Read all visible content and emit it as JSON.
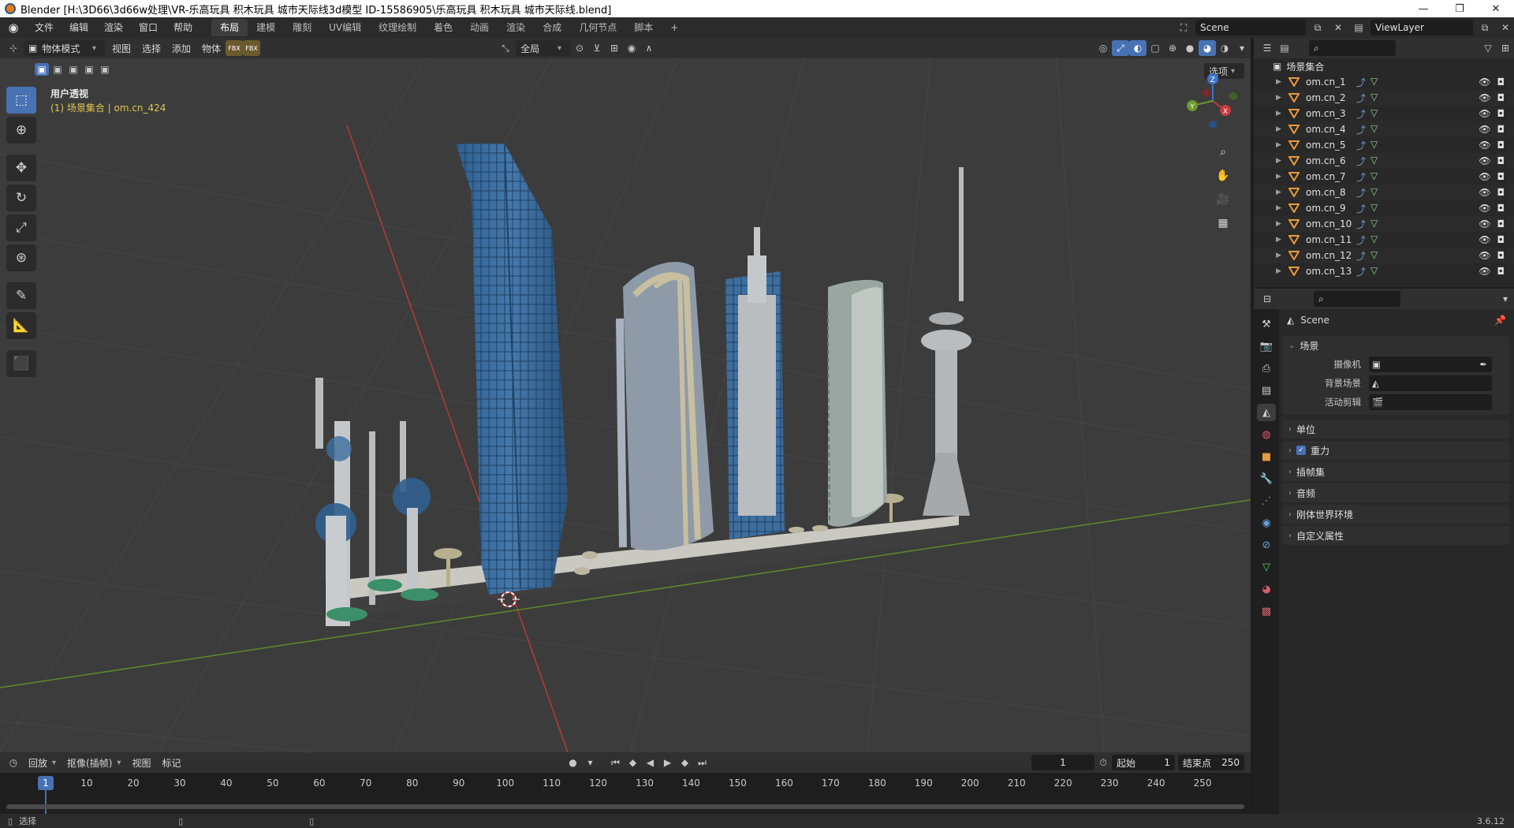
{
  "window": {
    "title": "Blender [H:\\3D66\\3d66w处理\\VR-乐高玩具 积木玩具 城市天际线3d模型 ID-15586905\\乐高玩具 积木玩具 城市天际线.blend]",
    "minimize": "—",
    "maximize": "❐",
    "close": "✕"
  },
  "menu": {
    "items": [
      "文件",
      "编辑",
      "渲染",
      "窗口",
      "帮助"
    ],
    "workspace_tabs": [
      "布局",
      "建模",
      "雕刻",
      "UV编辑",
      "纹理绘制",
      "着色",
      "动画",
      "渲染",
      "合成",
      "几何节点",
      "脚本"
    ],
    "active_tab": "布局",
    "add_tab": "+",
    "scene_name": "Scene",
    "view_layer": "ViewLayer"
  },
  "viewport_header": {
    "mode": "物体模式",
    "menus": [
      "视图",
      "选择",
      "添加",
      "物体"
    ],
    "transform_orientation": "全局",
    "options": "选项"
  },
  "viewport": {
    "view_name": "用户透视",
    "collection_info": "(1) 场景集合 | om.cn_424",
    "gizmo_axes": [
      "X",
      "Y",
      "Z"
    ]
  },
  "timeline": {
    "menus": [
      "回放",
      "抠像(插帧)",
      "视图",
      "标记"
    ],
    "current_frame": "1",
    "start_label": "起始",
    "start": "1",
    "end_label": "结束点",
    "end": "250",
    "ruler": [
      "1",
      "10",
      "20",
      "30",
      "40",
      "50",
      "60",
      "70",
      "80",
      "90",
      "100",
      "110",
      "120",
      "130",
      "140",
      "150",
      "160",
      "170",
      "180",
      "190",
      "200",
      "210",
      "220",
      "230",
      "240",
      "250"
    ]
  },
  "statusbar": {
    "select": "选择",
    "version": "3.6.12"
  },
  "outliner": {
    "collection": "场景集合",
    "objects": [
      "om.cn_1",
      "om.cn_2",
      "om.cn_3",
      "om.cn_4",
      "om.cn_5",
      "om.cn_6",
      "om.cn_7",
      "om.cn_8",
      "om.cn_9",
      "om.cn_10",
      "om.cn_11",
      "om.cn_12",
      "om.cn_13"
    ]
  },
  "properties": {
    "context": "Scene",
    "scene_panel": "场景",
    "camera_label": "摄像机",
    "background_label": "背景场景",
    "clip_label": "活动剪辑",
    "sections": [
      "单位",
      "重力",
      "插帧集",
      "音频",
      "刚体世界环境",
      "自定义属性"
    ]
  },
  "colors": {
    "accent": "#4772b3",
    "viewport_bg": "#3c3c3c",
    "panel_bg": "#282828",
    "info_text": "#e0c54a",
    "x_axis": "#c93a3a",
    "y_axis": "#6d9a2b",
    "z_axis": "#3b74c9",
    "glass_blue": "#3d6e9e"
  }
}
